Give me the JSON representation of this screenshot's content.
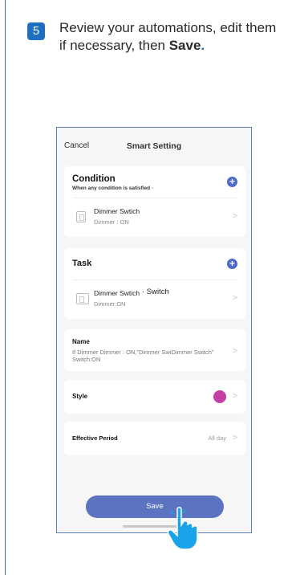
{
  "step": {
    "number": "5",
    "text": "Review your automations, edit them if necessary, then ",
    "bold": "Save",
    "dot": "."
  },
  "screen": {
    "cancel": "Cancel",
    "title": "Smart Setting",
    "condition": {
      "title": "Condition",
      "subtitle": "When any condition is satisfied ·",
      "item": {
        "name": "Dimmer Swtich",
        "state": "Dimmer : ON"
      }
    },
    "task": {
      "title": "Task",
      "item": {
        "name": "Dimmer Swtich",
        "extra": "· Switch",
        "state": "Dimmer:ON"
      }
    },
    "name": {
      "label": "Name",
      "value": "If Dimmer Dimmer : ON,\"Dimmer SwiDimmer Switch\" Switch:ON"
    },
    "style": {
      "label": "Style",
      "color": "#c43ea3"
    },
    "period": {
      "label": "Effective Period",
      "value": "All day"
    },
    "save": "Save"
  },
  "icons": {
    "plus": "+",
    "chevron": ">"
  },
  "colors": {
    "accent": "#1e6fc0",
    "button": "#5c73c2",
    "hand": "#1aa3e8"
  }
}
